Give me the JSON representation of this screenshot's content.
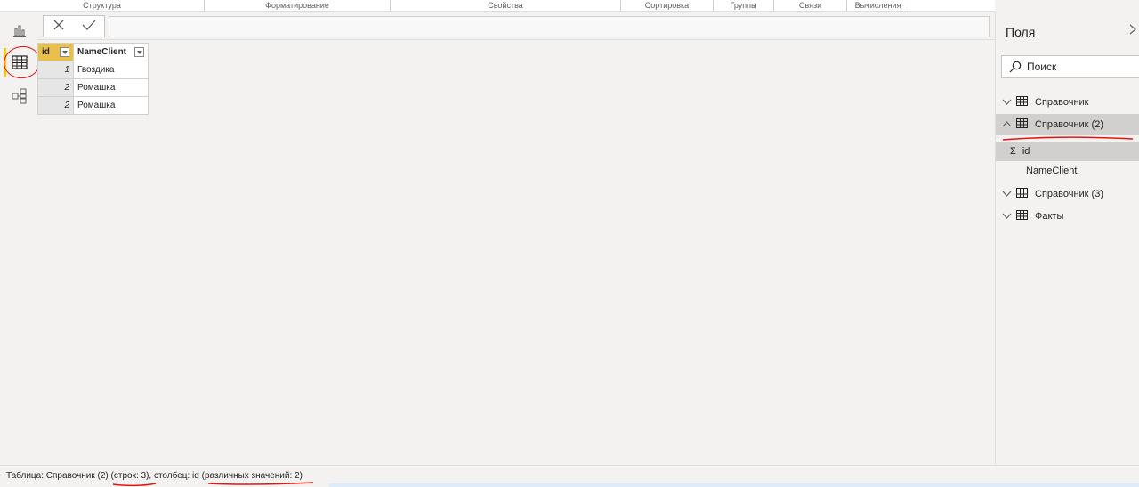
{
  "ribbon": {
    "groups": [
      "Структура",
      "Форматирование",
      "Свойства",
      "Сортировка",
      "Группы",
      "Связи",
      "Вычисления"
    ]
  },
  "grid": {
    "columns": [
      "id",
      "NameClient"
    ],
    "rows": [
      {
        "id": "1",
        "name": "Гвоздика"
      },
      {
        "id": "2",
        "name": "Ромашка"
      },
      {
        "id": "2",
        "name": "Ромашка"
      }
    ]
  },
  "fields_pane": {
    "title": "Поля",
    "search_placeholder": "Поиск",
    "tables": [
      {
        "name": "Справочник"
      },
      {
        "name": "Справочник (2)"
      },
      {
        "name": "Справочник (3)"
      },
      {
        "name": "Факты"
      }
    ],
    "expanded_fields": [
      {
        "name": "id",
        "icon": "sigma-icon"
      },
      {
        "name": "NameClient"
      }
    ]
  },
  "status": {
    "text": "Таблица: Справочник (2) (строк: 3), столбец: id (различных значений: 2)"
  },
  "colors": {
    "accent_yellow": "#f2c811",
    "selected_header": "#e8c04a",
    "annotation_red": "#e8130e"
  }
}
